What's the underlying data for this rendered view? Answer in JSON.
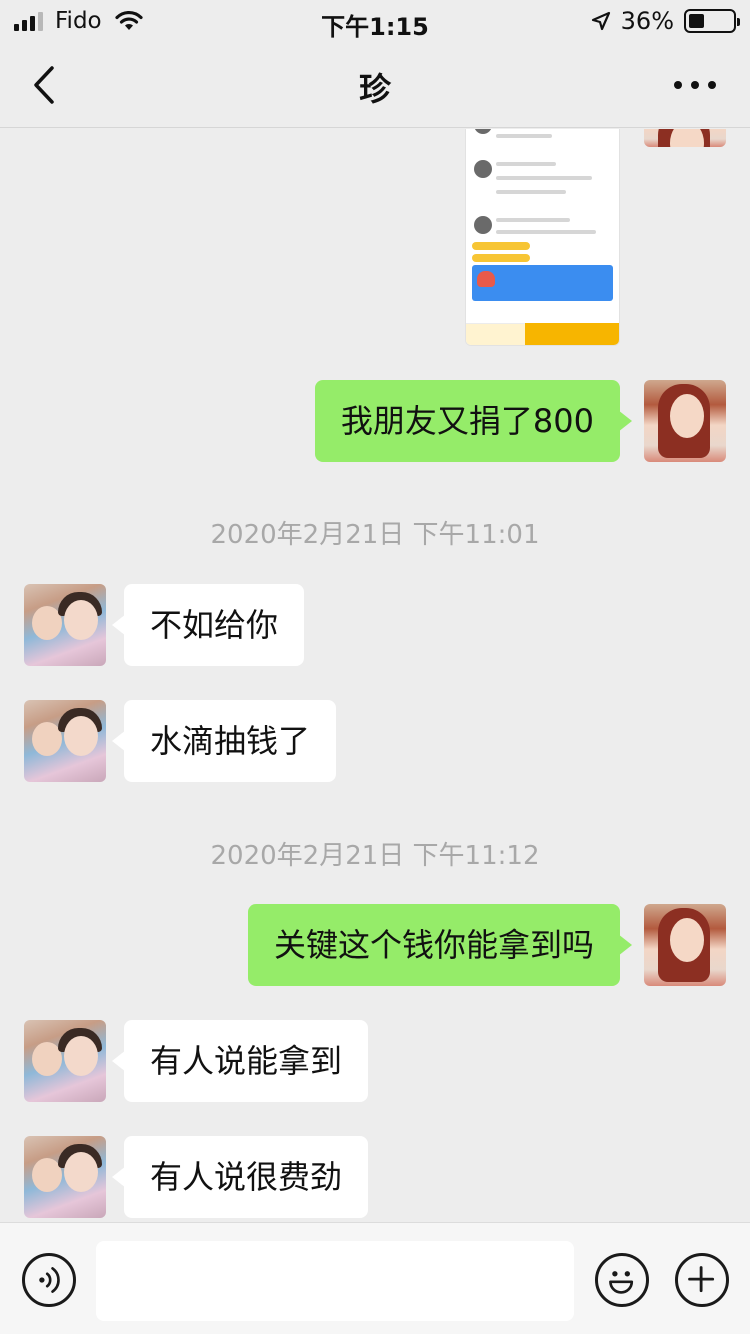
{
  "status_bar": {
    "carrier": "Fido",
    "time": "下午1:15",
    "battery_text": "36%",
    "battery_level": 0.36
  },
  "nav": {
    "title": "珍"
  },
  "messages": [
    {
      "side": "right",
      "type": "image"
    },
    {
      "side": "right",
      "type": "text",
      "text": "我朋友又捐了800"
    },
    {
      "type": "timestamp",
      "text": "2020年2月21日 下午11:01"
    },
    {
      "side": "left",
      "type": "text",
      "text": "不如给你"
    },
    {
      "side": "left",
      "type": "text",
      "text": "水滴抽钱了"
    },
    {
      "type": "timestamp",
      "text": "2020年2月21日 下午11:12"
    },
    {
      "side": "right",
      "type": "text",
      "text": "关键这个钱你能拿到吗"
    },
    {
      "side": "left",
      "type": "text",
      "text": "有人说能拿到"
    },
    {
      "side": "left",
      "type": "text",
      "text": "有人说很费劲"
    }
  ],
  "input_bar": {
    "placeholder": "",
    "icons": [
      "voice-icon",
      "emoji-icon",
      "plus-icon"
    ]
  },
  "colors": {
    "background": "#ededed",
    "bubble_me": "#95ec69",
    "bubble_other": "#ffffff",
    "timestamp": "#a8a8a8"
  }
}
